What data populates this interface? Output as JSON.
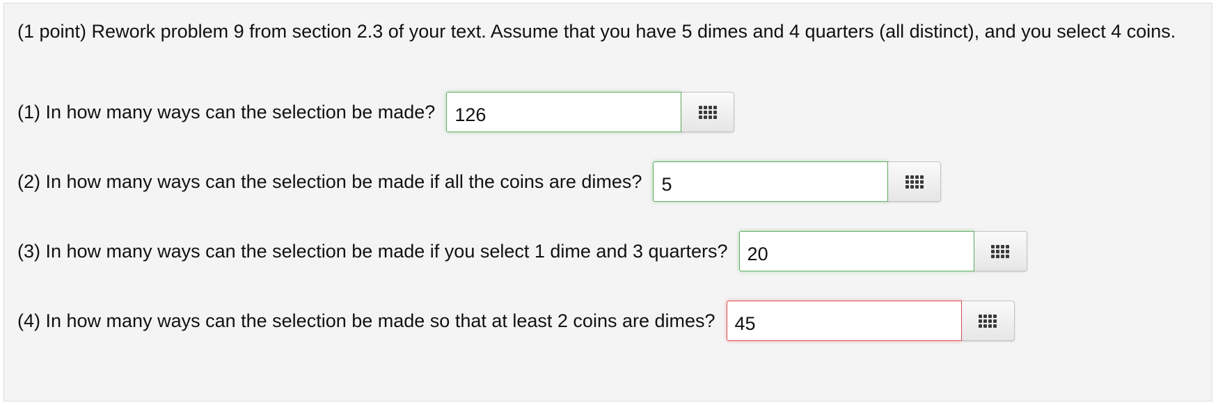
{
  "problem": {
    "intro": "(1 point) Rework problem 9 from section 2.3 of your text. Assume that you have 5 dimes and 4 quarters (all distinct), and you select 4 coins."
  },
  "questions": [
    {
      "text": "(1) In how many ways can the selection be made?",
      "answer": "126",
      "status": "correct"
    },
    {
      "text": "(2) In how many ways can the selection be made if all the coins are dimes?",
      "answer": "5",
      "status": "correct"
    },
    {
      "text": "(3) In how many ways can the selection be made if you select 1 dime and 3 quarters?",
      "answer": "20",
      "status": "correct"
    },
    {
      "text": "(4) In how many ways can the selection be made so that at least 2 coins are dimes?",
      "answer": "45",
      "status": "incorrect"
    }
  ],
  "icons": {
    "palette": "equation-palette-grid-icon"
  },
  "colors": {
    "correct_border": "#5fb05f",
    "incorrect_border": "#d9534f",
    "panel_background": "#f4f4f4"
  }
}
